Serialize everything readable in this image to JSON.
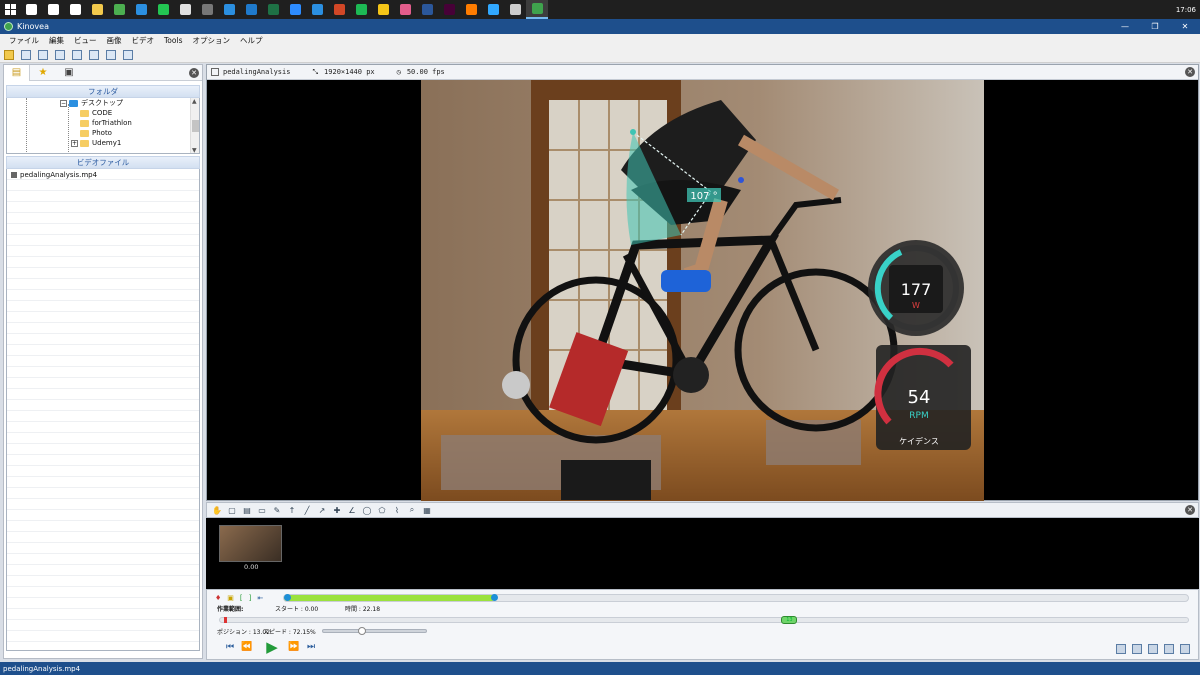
{
  "taskbar": {
    "clock": "17:06",
    "icons": [
      {
        "name": "search-icon",
        "color": "#ffffff"
      },
      {
        "name": "cortana-icon",
        "color": "#ffffff"
      },
      {
        "name": "task-view-icon",
        "color": "#ffffff"
      },
      {
        "name": "explorer-icon",
        "color": "#f2c94c"
      },
      {
        "name": "chrome-icon",
        "color": "#4caf50"
      },
      {
        "name": "store-icon",
        "color": "#2b8fe0"
      },
      {
        "name": "line-icon",
        "color": "#23c552"
      },
      {
        "name": "app-icon-1",
        "color": "#e0e0e0"
      },
      {
        "name": "terminal-icon",
        "color": "#777777"
      },
      {
        "name": "vscode-icon",
        "color": "#2b8fe0"
      },
      {
        "name": "app-icon-2",
        "color": "#1f7acc"
      },
      {
        "name": "excel-icon",
        "color": "#1e7145"
      },
      {
        "name": "zoom-icon",
        "color": "#2d8cff"
      },
      {
        "name": "app-icon-3",
        "color": "#2b8fe0"
      },
      {
        "name": "powerpoint-icon",
        "color": "#d24726"
      },
      {
        "name": "spotify-icon",
        "color": "#1db954"
      },
      {
        "name": "keep-icon",
        "color": "#f5c518"
      },
      {
        "name": "app-icon-4",
        "color": "#e35d8c"
      },
      {
        "name": "word-icon",
        "color": "#2b579a"
      },
      {
        "name": "xd-icon",
        "color": "#470137"
      },
      {
        "name": "illustrator-icon",
        "color": "#ff7c00"
      },
      {
        "name": "photoshop-icon",
        "color": "#31a8ff"
      },
      {
        "name": "acrobat-icon",
        "color": "#cccccc"
      },
      {
        "name": "kinovea-taskbar-icon",
        "color": "#3fa34d",
        "active": true
      }
    ]
  },
  "window": {
    "title": "Kinovea",
    "controls": {
      "minimize": "—",
      "maximize": "❐",
      "close": "✕"
    }
  },
  "menu": {
    "items": [
      "ファイル",
      "編集",
      "ビュー",
      "画像",
      "ビデオ",
      "Tools",
      "オプション",
      "ヘルプ"
    ]
  },
  "left_panel": {
    "folder_header": "フォルダ",
    "video_header": "ビデオファイル",
    "tree": [
      {
        "label": "デスクトップ",
        "level": 0,
        "expander": "⊖",
        "blue": true
      },
      {
        "label": "CODE",
        "level": 1
      },
      {
        "label": "forTriathlon",
        "level": 1
      },
      {
        "label": "Photo",
        "level": 1
      },
      {
        "label": "Udemy1",
        "level": 1,
        "expander": "⊞"
      }
    ],
    "files": [
      "pedalingAnalysis.mp4"
    ]
  },
  "viewer": {
    "file": "pedalingAnalysis",
    "resolution": "1920×1440 px",
    "fps": "50.00 fps",
    "overlay": {
      "angle": "107 °",
      "power_value": "177",
      "power_unit": "W",
      "cadence_value": "54",
      "cadence_unit": "RPM",
      "cadence_caption": "ケイデンス"
    }
  },
  "keyframe": {
    "time": "0.00"
  },
  "playback": {
    "range_label": "作業範囲:",
    "start_label": "スタート : 0.00",
    "duration_label": "時間 : 22.18",
    "position_label": "ポジション : 13.02",
    "speed_label": "スピード : 72.15%",
    "speed_fraction": 0.3722,
    "position_fraction": 0.587,
    "range_fraction": 0.233,
    "position_badge": "13"
  },
  "status": {
    "text": "pedalingAnalysis.mp4"
  }
}
